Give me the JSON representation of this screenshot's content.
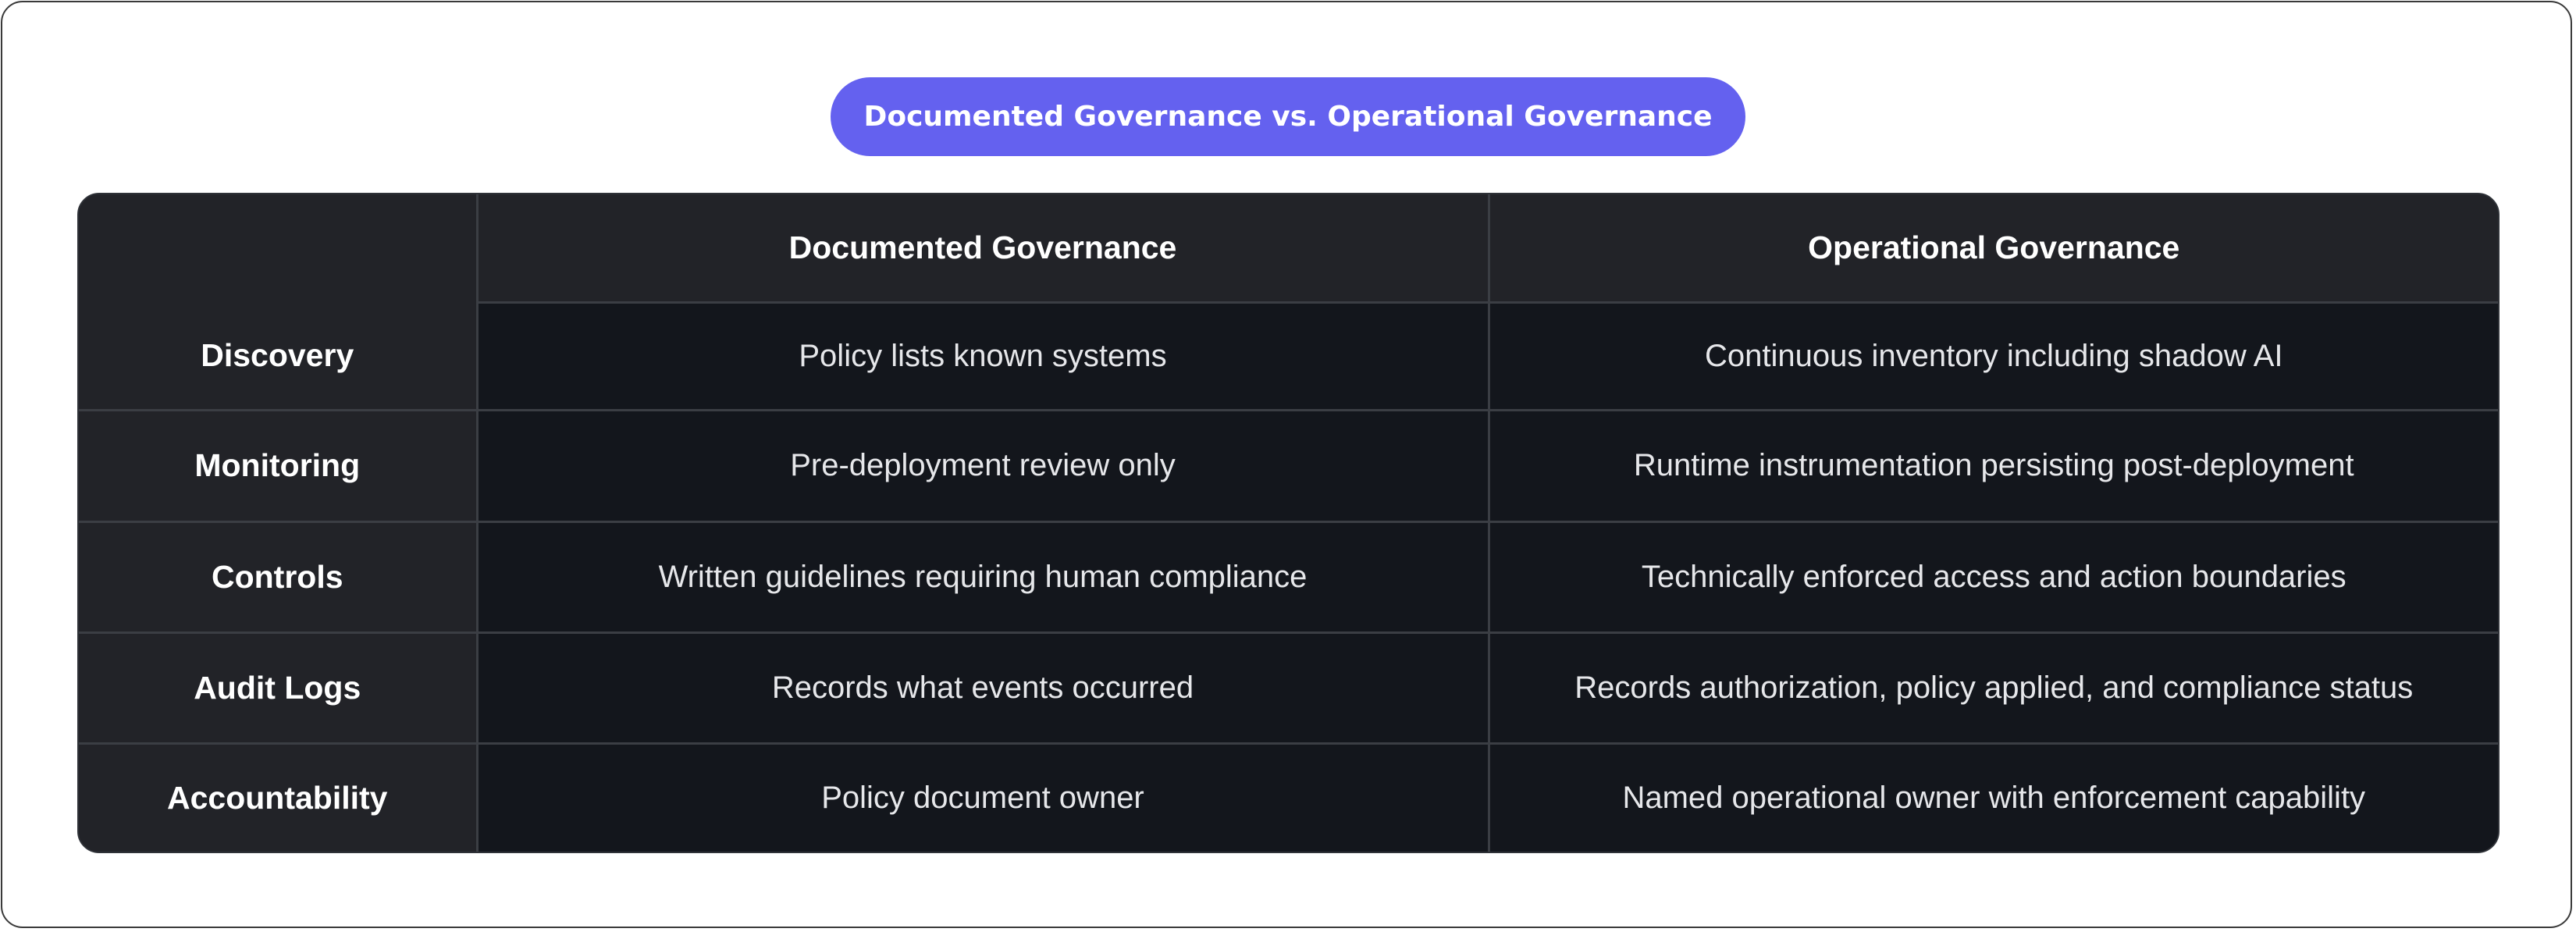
{
  "title": "Documented Governance vs. Operational Governance",
  "table": {
    "headers": [
      "",
      "Documented Governance",
      "Operational Governance"
    ],
    "rows": [
      {
        "label": "Discovery",
        "documented": "Policy lists known systems",
        "operational": "Continuous inventory including shadow AI"
      },
      {
        "label": "Monitoring",
        "documented": "Pre-deployment review only",
        "operational": "Runtime instrumentation persisting post-deployment"
      },
      {
        "label": "Controls",
        "documented": "Written guidelines requiring human compliance",
        "operational": "Technically enforced access and action boundaries"
      },
      {
        "label": "Audit Logs",
        "documented": "Records what events occurred",
        "operational": "Records authorization, policy applied, and compliance status"
      },
      {
        "label": "Accountability",
        "documented": "Policy document owner",
        "operational": "Named operational owner with enforcement capability"
      }
    ]
  },
  "colors": {
    "accent": "#6461ef",
    "table_background": "#13161c",
    "header_background": "#222328",
    "grid_lines": "#3b3e44"
  }
}
